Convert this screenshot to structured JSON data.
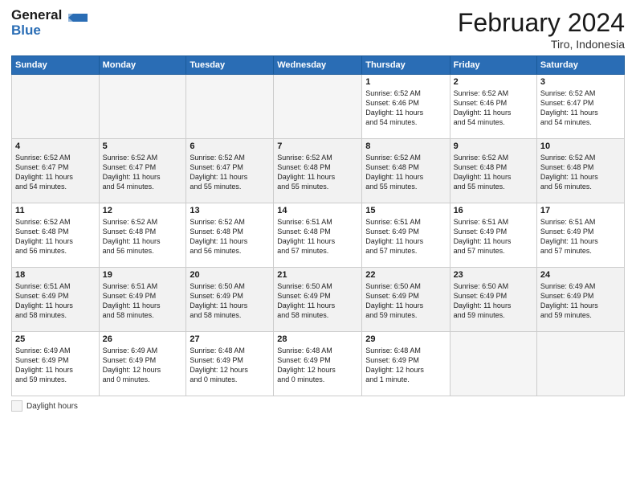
{
  "header": {
    "logo_line1": "General",
    "logo_line2": "Blue",
    "month_title": "February 2024",
    "location": "Tiro, Indonesia"
  },
  "footer": {
    "daylight_label": "Daylight hours"
  },
  "weekdays": [
    "Sunday",
    "Monday",
    "Tuesday",
    "Wednesday",
    "Thursday",
    "Friday",
    "Saturday"
  ],
  "weeks": [
    [
      {
        "day": "",
        "info": ""
      },
      {
        "day": "",
        "info": ""
      },
      {
        "day": "",
        "info": ""
      },
      {
        "day": "",
        "info": ""
      },
      {
        "day": "1",
        "info": "Sunrise: 6:52 AM\nSunset: 6:46 PM\nDaylight: 11 hours\nand 54 minutes."
      },
      {
        "day": "2",
        "info": "Sunrise: 6:52 AM\nSunset: 6:46 PM\nDaylight: 11 hours\nand 54 minutes."
      },
      {
        "day": "3",
        "info": "Sunrise: 6:52 AM\nSunset: 6:47 PM\nDaylight: 11 hours\nand 54 minutes."
      }
    ],
    [
      {
        "day": "4",
        "info": "Sunrise: 6:52 AM\nSunset: 6:47 PM\nDaylight: 11 hours\nand 54 minutes."
      },
      {
        "day": "5",
        "info": "Sunrise: 6:52 AM\nSunset: 6:47 PM\nDaylight: 11 hours\nand 54 minutes."
      },
      {
        "day": "6",
        "info": "Sunrise: 6:52 AM\nSunset: 6:47 PM\nDaylight: 11 hours\nand 55 minutes."
      },
      {
        "day": "7",
        "info": "Sunrise: 6:52 AM\nSunset: 6:48 PM\nDaylight: 11 hours\nand 55 minutes."
      },
      {
        "day": "8",
        "info": "Sunrise: 6:52 AM\nSunset: 6:48 PM\nDaylight: 11 hours\nand 55 minutes."
      },
      {
        "day": "9",
        "info": "Sunrise: 6:52 AM\nSunset: 6:48 PM\nDaylight: 11 hours\nand 55 minutes."
      },
      {
        "day": "10",
        "info": "Sunrise: 6:52 AM\nSunset: 6:48 PM\nDaylight: 11 hours\nand 56 minutes."
      }
    ],
    [
      {
        "day": "11",
        "info": "Sunrise: 6:52 AM\nSunset: 6:48 PM\nDaylight: 11 hours\nand 56 minutes."
      },
      {
        "day": "12",
        "info": "Sunrise: 6:52 AM\nSunset: 6:48 PM\nDaylight: 11 hours\nand 56 minutes."
      },
      {
        "day": "13",
        "info": "Sunrise: 6:52 AM\nSunset: 6:48 PM\nDaylight: 11 hours\nand 56 minutes."
      },
      {
        "day": "14",
        "info": "Sunrise: 6:51 AM\nSunset: 6:48 PM\nDaylight: 11 hours\nand 57 minutes."
      },
      {
        "day": "15",
        "info": "Sunrise: 6:51 AM\nSunset: 6:49 PM\nDaylight: 11 hours\nand 57 minutes."
      },
      {
        "day": "16",
        "info": "Sunrise: 6:51 AM\nSunset: 6:49 PM\nDaylight: 11 hours\nand 57 minutes."
      },
      {
        "day": "17",
        "info": "Sunrise: 6:51 AM\nSunset: 6:49 PM\nDaylight: 11 hours\nand 57 minutes."
      }
    ],
    [
      {
        "day": "18",
        "info": "Sunrise: 6:51 AM\nSunset: 6:49 PM\nDaylight: 11 hours\nand 58 minutes."
      },
      {
        "day": "19",
        "info": "Sunrise: 6:51 AM\nSunset: 6:49 PM\nDaylight: 11 hours\nand 58 minutes."
      },
      {
        "day": "20",
        "info": "Sunrise: 6:50 AM\nSunset: 6:49 PM\nDaylight: 11 hours\nand 58 minutes."
      },
      {
        "day": "21",
        "info": "Sunrise: 6:50 AM\nSunset: 6:49 PM\nDaylight: 11 hours\nand 58 minutes."
      },
      {
        "day": "22",
        "info": "Sunrise: 6:50 AM\nSunset: 6:49 PM\nDaylight: 11 hours\nand 59 minutes."
      },
      {
        "day": "23",
        "info": "Sunrise: 6:50 AM\nSunset: 6:49 PM\nDaylight: 11 hours\nand 59 minutes."
      },
      {
        "day": "24",
        "info": "Sunrise: 6:49 AM\nSunset: 6:49 PM\nDaylight: 11 hours\nand 59 minutes."
      }
    ],
    [
      {
        "day": "25",
        "info": "Sunrise: 6:49 AM\nSunset: 6:49 PM\nDaylight: 11 hours\nand 59 minutes."
      },
      {
        "day": "26",
        "info": "Sunrise: 6:49 AM\nSunset: 6:49 PM\nDaylight: 12 hours\nand 0 minutes."
      },
      {
        "day": "27",
        "info": "Sunrise: 6:48 AM\nSunset: 6:49 PM\nDaylight: 12 hours\nand 0 minutes."
      },
      {
        "day": "28",
        "info": "Sunrise: 6:48 AM\nSunset: 6:49 PM\nDaylight: 12 hours\nand 0 minutes."
      },
      {
        "day": "29",
        "info": "Sunrise: 6:48 AM\nSunset: 6:49 PM\nDaylight: 12 hours\nand 1 minute."
      },
      {
        "day": "",
        "info": ""
      },
      {
        "day": "",
        "info": ""
      }
    ]
  ]
}
